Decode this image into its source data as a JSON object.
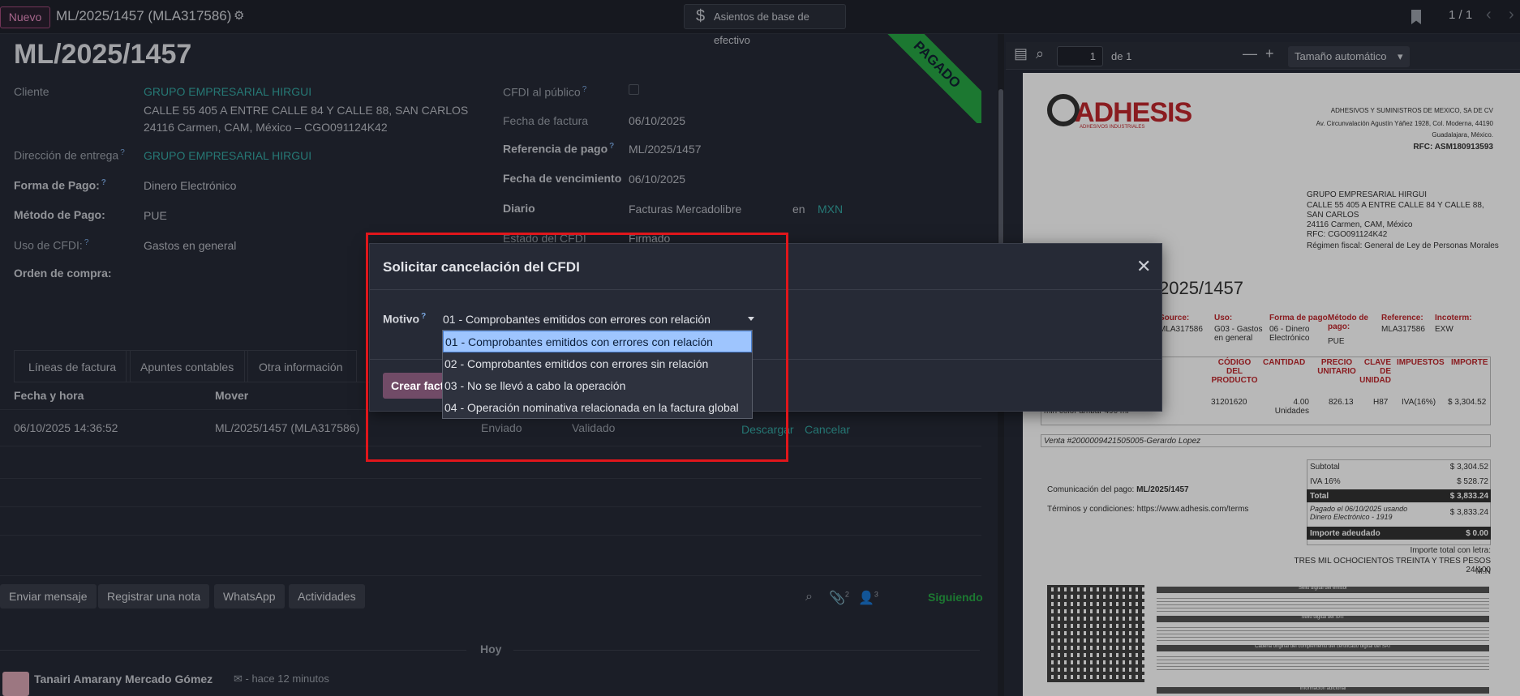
{
  "topbar": {
    "new_label": "Nuevo",
    "record_title": "ML/2025/1457 (MLA317586)",
    "cash_basis_label": "Asientos de base de efectivo",
    "pager": "1 / 1"
  },
  "form": {
    "title": "ML/2025/1457",
    "ribbon": "PAGADO",
    "customer_label": "Cliente",
    "customer_name": "GRUPO EMPRESARIAL HIRGUI",
    "customer_addr1": "CALLE 55 405 A ENTRE CALLE 84 Y CALLE 88, SAN CARLOS",
    "customer_addr2": "24116 Carmen, CAM, México – CGO091124K42",
    "delivery_label": "Dirección de entrega",
    "delivery_value": "GRUPO EMPRESARIAL HIRGUI",
    "payment_form_label": "Forma de Pago:",
    "payment_form_value": "Dinero Electrónico",
    "payment_method_label": "Método de Pago:",
    "payment_method_value": "PUE",
    "cfdi_use_label": "Uso de CFDI:",
    "cfdi_use_value": "Gastos en general",
    "po_label": "Orden de compra:",
    "public_label": "CFDI al público",
    "invoice_date_label": "Fecha de factura",
    "invoice_date_value": "06/10/2025",
    "payment_ref_label": "Referencia de pago",
    "payment_ref_value": "ML/2025/1457",
    "due_date_label": "Fecha de vencimiento",
    "due_date_value": "06/10/2025",
    "journal_label": "Diario",
    "journal_value": "Facturas Mercadolibre",
    "journal_in": "en",
    "journal_currency": "MXN",
    "cfdi_state_label": "Estado del CFDI",
    "cfdi_state_value": "Firmado"
  },
  "tabs": [
    "Líneas de factura",
    "Apuntes contables",
    "Otra información"
  ],
  "cfdi_table": {
    "headers": [
      "Fecha y hora",
      "Mover"
    ],
    "row": {
      "datetime": "06/10/2025 14:36:52",
      "move": "ML/2025/1457 (MLA317586)",
      "sent": "Enviado",
      "validated": "Validado",
      "download": "Descargar",
      "cancel": "Cancelar"
    }
  },
  "chatter": {
    "send_message": "Enviar mensaje",
    "log_note": "Registrar una nota",
    "whatsapp": "WhatsApp",
    "activities": "Actividades",
    "attachments_count": "2",
    "followers_count": "3",
    "following": "Siguiendo",
    "today": "Hoy",
    "author": "Tanairi Amarany Mercado Gómez",
    "time_ago": "- hace 12 minutos"
  },
  "pdf": {
    "page_input": "1",
    "of_pages": "de 1",
    "zoom": "Tamaño automático",
    "company_name": "ADHESIVOS Y SUMINISTROS DE MEXICO, SA DE CV",
    "company_addr1": "Av. Circunvalación Agustín Yáñez 1928, Col. Moderna, 44190",
    "company_addr2": "Guadalajara, México.",
    "company_rfc": "RFC: ASM180913593",
    "logo": "ADHESIS",
    "logo_tagline": "ADHESIVOS INDUSTRIALES",
    "client_lines": [
      "GRUPO EMPRESARIAL HIRGUI",
      "CALLE 55 405 A ENTRE CALLE 84 Y CALLE 88,",
      "SAN CARLOS",
      "24116 Carmen, CAM, México",
      "RFC: CGO091124K42",
      "Régimen fiscal: General de Ley de Personas Morales"
    ],
    "invoice_title": "2025/1457",
    "meta_labels": [
      "Source:",
      "Uso:",
      "Forma de pago:",
      "Método de pago:",
      "Reference:",
      "Incoterm:"
    ],
    "meta_values": [
      "MLA317586",
      "G03 - Gastos en general",
      "06 - Dinero Electrónico",
      "PUE",
      "MLA317586",
      "EXW"
    ],
    "table_headers": [
      "CÓDIGO DEL PRODUCTO",
      "CANTIDAD",
      "PRECIO UNITARIO",
      "CLAVE DE UNIDAD",
      "IMPUESTOS",
      "IMPORTE"
    ],
    "line_desc": "estructural, curado medio de 4-6 min color ámbar 490 ml",
    "line_code": "31201620",
    "line_qty": "4.00 Unidades",
    "line_price": "826.13",
    "line_unit": "H87",
    "line_tax": "IVA(16%)",
    "line_amount": "$ 3,304.52",
    "sale_note": "Venta #2000009421505005-Gerardo Lopez",
    "subtotal_label": "Subtotal",
    "subtotal_value": "$ 3,304.52",
    "iva_label": "IVA 16%",
    "iva_value": "$ 528.72",
    "total_label": "Total",
    "total_value": "$ 3,833.24",
    "paid_note": "Pagado el 06/10/2025 usando Dinero Electrónico - 1919",
    "paid_value": "$ 3,833.24",
    "due_label": "Importe adeudado",
    "due_value": "$ 0.00",
    "payment_comm": "Comunicación del pago:",
    "payment_comm_value": "ML/2025/1457",
    "terms": "Términos y condiciones: https://www.adhesis.com/terms",
    "amount_words_label": "Importe total con letra:",
    "amount_words": "TRES MIL OCHOCIENTOS TREINTA Y TRES PESOS 24/100",
    "amount_words_cur": "M.N",
    "stamp_labels": [
      "Sello digital del emisor",
      "Sello digital del SAT",
      "Cadena original del complemento del certificado digital del SAT",
      "Información adicional"
    ]
  },
  "modal": {
    "title": "Solicitar cancelación del CFDI",
    "reason_label": "Motivo",
    "reason_selected": "01 - Comprobantes emitidos con errores con relación",
    "primary_button": "Crear factura",
    "options": [
      "01 - Comprobantes emitidos con errores con relación",
      "02 - Comprobantes emitidos con errores sin relación",
      "03 - No se llevó a cabo la operación",
      "04 - Operación nominativa relacionada en la factura global"
    ]
  }
}
